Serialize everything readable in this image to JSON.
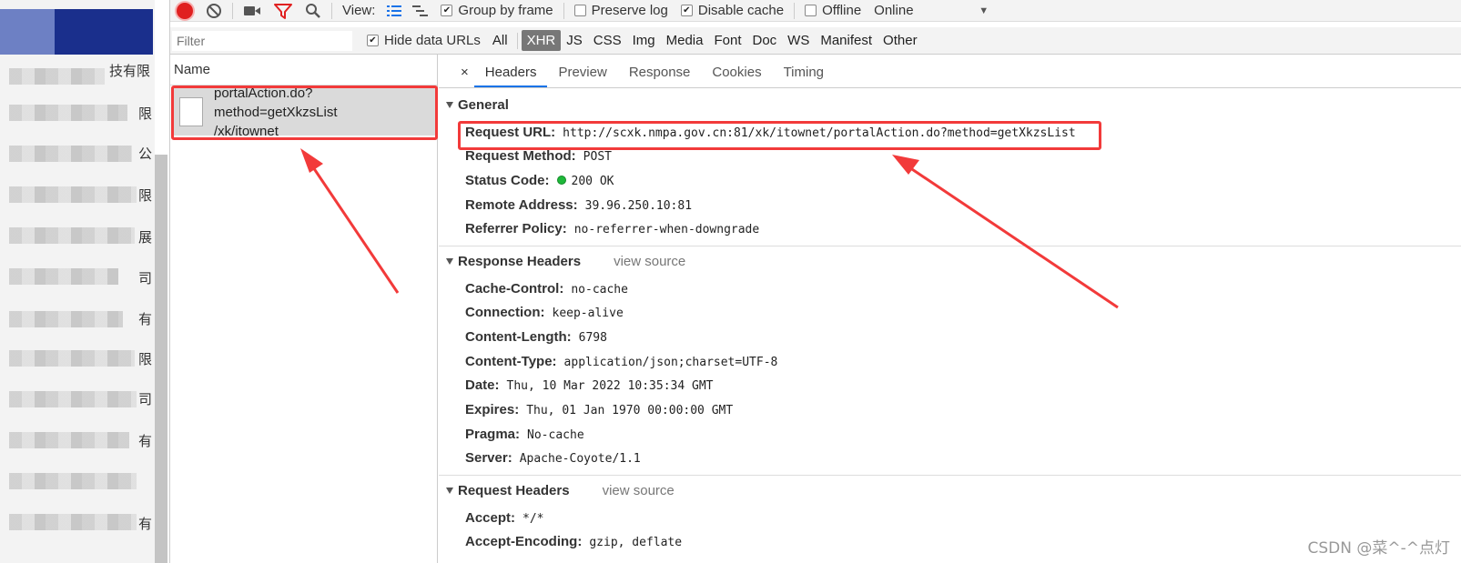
{
  "left_page": {
    "glyphs": [
      "技有限",
      "限",
      "公",
      "限",
      "展",
      "司",
      "有",
      "限",
      "司",
      "有",
      "有"
    ]
  },
  "toolbar": {
    "view_label": "View:",
    "group_by_frame": "Group by frame",
    "preserve_log": "Preserve log",
    "disable_cache": "Disable cache",
    "offline": "Offline",
    "throttle_value": "Online"
  },
  "filterbar": {
    "filter_placeholder": "Filter",
    "hide_data_urls": "Hide data URLs",
    "types": [
      "All",
      "XHR",
      "JS",
      "CSS",
      "Img",
      "Media",
      "Font",
      "Doc",
      "WS",
      "Manifest",
      "Other"
    ]
  },
  "name_panel": {
    "header": "Name",
    "request_line1": "portalAction.do?method=getXkzsList",
    "request_line2": "/xk/itownet"
  },
  "tabs": [
    "×",
    "Headers",
    "Preview",
    "Response",
    "Cookies",
    "Timing"
  ],
  "general": {
    "title": "General",
    "request_url_k": "Request URL:",
    "request_url_v": "http://scxk.nmpa.gov.cn:81/xk/itownet/portalAction.do?method=getXkzsList",
    "request_method_k": "Request Method:",
    "request_method_v": "POST",
    "status_code_k": "Status Code:",
    "status_code_v": "200 OK",
    "remote_address_k": "Remote Address:",
    "remote_address_v": "39.96.250.10:81",
    "referrer_policy_k": "Referrer Policy:",
    "referrer_policy_v": "no-referrer-when-downgrade"
  },
  "response_headers": {
    "title": "Response Headers",
    "view_source": "view source",
    "items": [
      {
        "k": "Cache-Control:",
        "v": "no-cache"
      },
      {
        "k": "Connection:",
        "v": "keep-alive"
      },
      {
        "k": "Content-Length:",
        "v": "6798"
      },
      {
        "k": "Content-Type:",
        "v": "application/json;charset=UTF-8"
      },
      {
        "k": "Date:",
        "v": "Thu, 10 Mar 2022 10:35:34 GMT"
      },
      {
        "k": "Expires:",
        "v": "Thu, 01 Jan 1970 00:00:00 GMT"
      },
      {
        "k": "Pragma:",
        "v": "No-cache"
      },
      {
        "k": "Server:",
        "v": "Apache-Coyote/1.1"
      }
    ]
  },
  "request_headers": {
    "title": "Request Headers",
    "view_source": "view source",
    "items": [
      {
        "k": "Accept:",
        "v": "*/*"
      },
      {
        "k": "Accept-Encoding:",
        "v": "gzip, deflate"
      }
    ]
  },
  "watermark": "CSDN @菜^-^点灯",
  "colors": {
    "highlight": "#f23a3a",
    "status_green": "#1eb83a",
    "record_red": "#e02020",
    "filter_red": "#e02020",
    "active_type_bg": "#777777"
  }
}
